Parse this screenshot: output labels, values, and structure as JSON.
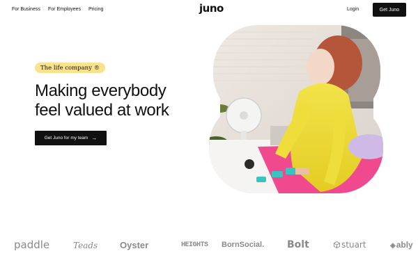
{
  "nav": {
    "links": [
      "For Business",
      "For Employees",
      "Pricing"
    ],
    "logo": "juno",
    "login": "Login",
    "cta": "Get Juno"
  },
  "hero": {
    "pill": "The life company",
    "pill_mark": "®",
    "headline_line1": "Making everybody",
    "headline_line2": "feel valued at work",
    "cta": "Get Juno for my team",
    "cta_arrow": "→"
  },
  "brands": [
    "paddle",
    "Teads",
    "Oyster",
    "HEIGHTS",
    "BornSocial.",
    "Bolt",
    "stuart",
    "ably"
  ],
  "colors": {
    "pill_bg": "#fbe28c",
    "button_bg": "#111111",
    "brand_gray": "#8a8a8a"
  }
}
